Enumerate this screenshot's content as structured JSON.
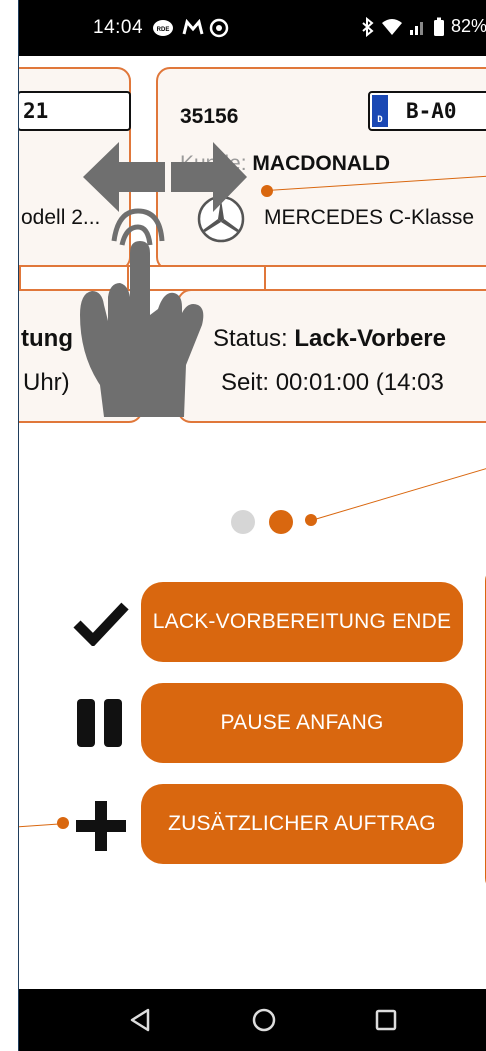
{
  "statusbar": {
    "time": "14:04",
    "icons": [
      "rde-badge-icon",
      "m-logo-icon",
      "sync-icon"
    ],
    "right_icons": [
      "bluetooth-icon",
      "wifi-icon",
      "signal-icon",
      "battery-icon"
    ],
    "battery": "82%"
  },
  "cards": {
    "left": {
      "plate_fragment": "21",
      "model_fragment": "odell 2..."
    },
    "main": {
      "order_number": "35156",
      "plate": "B-A0",
      "plate_country": "D",
      "customer_label": "Kunde: ",
      "customer_name": "MACDONALD",
      "brand_icon": "mercedes-logo-icon",
      "model": "MERCEDES C-Klasse"
    },
    "status_left": {
      "line1_fragment": "tung",
      "line2_fragment": "Uhr)"
    },
    "status_main": {
      "status_label": "Status: ",
      "status_value": "Lack-Vorbere",
      "since_text": "Seit: 00:01:00 (14:03"
    }
  },
  "gesture": {
    "icon": "swipe-hand-icon",
    "arrows": [
      "arrow-left-icon",
      "arrow-right-icon"
    ]
  },
  "pager": {
    "pages": 2,
    "active": 2,
    "inactive_color": "#d6d6d6",
    "active_color": "#d9670f"
  },
  "actions": [
    {
      "icon": "checkmark-icon",
      "label": "LACK-VORBEREITUNG ENDE"
    },
    {
      "icon": "pause-icon",
      "label": "PAUSE ANFANG"
    },
    {
      "icon": "plus-icon",
      "label": "ZUSÄTZLICHER AUFTRAG"
    }
  ],
  "navbar": {
    "icons": [
      "back-icon",
      "home-icon",
      "recents-icon"
    ]
  },
  "colors": {
    "accent": "#d9670f",
    "card_border": "#e0773a",
    "text": "#111111"
  }
}
